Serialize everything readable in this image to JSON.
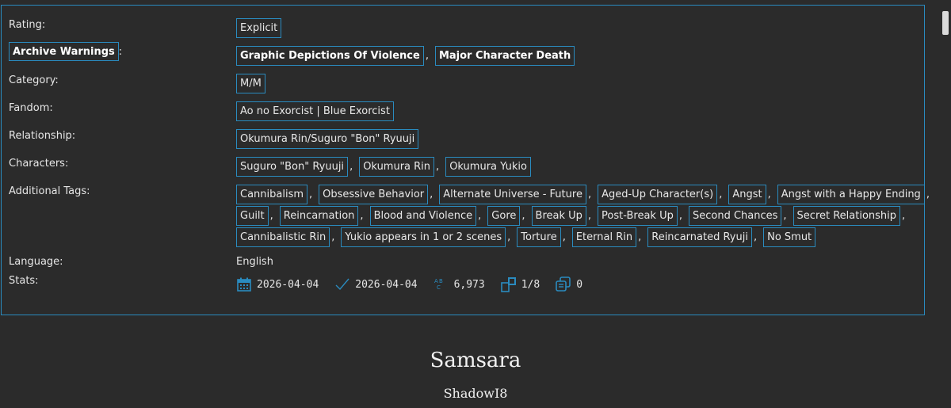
{
  "meta": {
    "rating": {
      "label": "Rating:",
      "tags": [
        "Explicit"
      ]
    },
    "warnings": {
      "label": "Archive Warnings",
      "colon": ":",
      "tags": [
        "Graphic Depictions Of Violence",
        "Major Character Death"
      ]
    },
    "category": {
      "label": "Category:",
      "tags": [
        "M/M"
      ]
    },
    "fandom": {
      "label": "Fandom:",
      "tags": [
        "Ao no Exorcist | Blue Exorcist"
      ]
    },
    "relationship": {
      "label": "Relationship:",
      "tags": [
        "Okumura Rin/Suguro \"Bon\" Ryuuji"
      ]
    },
    "characters": {
      "label": "Characters:",
      "tags": [
        "Suguro \"Bon\" Ryuuji",
        "Okumura Rin",
        "Okumura Yukio"
      ]
    },
    "additional_tags": {
      "label": "Additional Tags:",
      "tags": [
        "Cannibalism",
        "Obsessive Behavior",
        "Alternate Universe - Future",
        "Aged-Up Character(s)",
        "Angst",
        "Angst with a Happy Ending",
        "Guilt",
        "Reincarnation",
        "Blood and Violence",
        "Gore",
        "Break Up",
        "Post-Break Up",
        "Second Chances",
        "Secret Relationship",
        "Cannibalistic Rin",
        "Yukio appears in 1 or 2 scenes",
        "Torture",
        "Eternal Rin",
        "Reincarnated Ryuji",
        "No Smut"
      ]
    },
    "language": {
      "label": "Language:",
      "value": "English"
    },
    "stats": {
      "label": "Stats:",
      "published": "2026-04-04",
      "updated": "2026-04-04",
      "words": "6,973",
      "chapters": "1/8",
      "comments": "0"
    },
    "separator": ","
  },
  "work": {
    "title": "Samsara",
    "author": "ShadowI8"
  },
  "colors": {
    "background": "#2b2b2b",
    "accent": "#2a8bbf",
    "text": "#e6e6e6"
  },
  "icons": {
    "published": "calendar-icon",
    "updated": "checkmark-icon",
    "words": "abc-icon",
    "chapters": "chapters-icon",
    "comments": "comments-icon"
  }
}
